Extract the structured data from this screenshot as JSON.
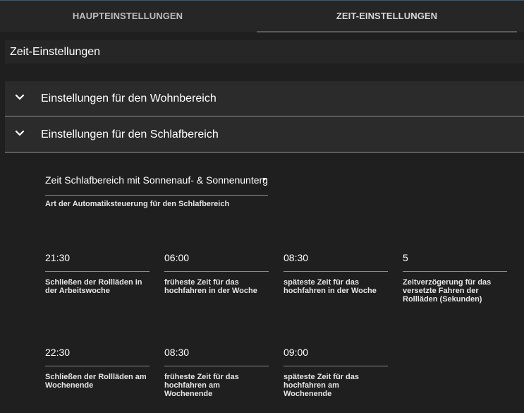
{
  "tabs": [
    {
      "label": "HAUPTEINSTELLUNGEN"
    },
    {
      "label": "ZEIT-EINSTELLUNGEN",
      "active": true
    }
  ],
  "section_title": "Zeit-Einstellungen",
  "panels": [
    {
      "label": "Einstellungen für den Wohnbereich",
      "icon": "chevron-down-icon"
    },
    {
      "label": "Einstellungen für den Schlafbereich",
      "icon": "chevron-down-icon"
    }
  ],
  "schlaf": {
    "select_value": "Zeit Schlafbereich mit Sonnenauf- & Sonnenuntergang",
    "select_help": "Art der Automatiksteuerung für den Schlafbereich",
    "fields_row1": [
      {
        "value": "21:30",
        "help": "Schließen der Rollläden in der Arbeitswoche"
      },
      {
        "value": "06:00",
        "help": "früheste Zeit für das hochfahren in der Woche"
      },
      {
        "value": "08:30",
        "help": "späteste Zeit für das hochfahren in der Woche"
      },
      {
        "value": "5",
        "help": "Zeitverzögerung für das versetzte Fahren der Rollläden (Sekunden)"
      }
    ],
    "fields_row2": [
      {
        "value": "22:30",
        "help": "Schließen der Rollläden am Wochenende"
      },
      {
        "value": "08:30",
        "help": "früheste Zeit für das hochfahren am Wochenende"
      },
      {
        "value": "09:00",
        "help": "späteste Zeit für das hochfahren am Wochenende"
      }
    ]
  },
  "colors": {
    "background": "#1f1f1f",
    "tab_bar": "#262626",
    "panel": "#2b2b2b",
    "divider": "#9a9a9a"
  }
}
